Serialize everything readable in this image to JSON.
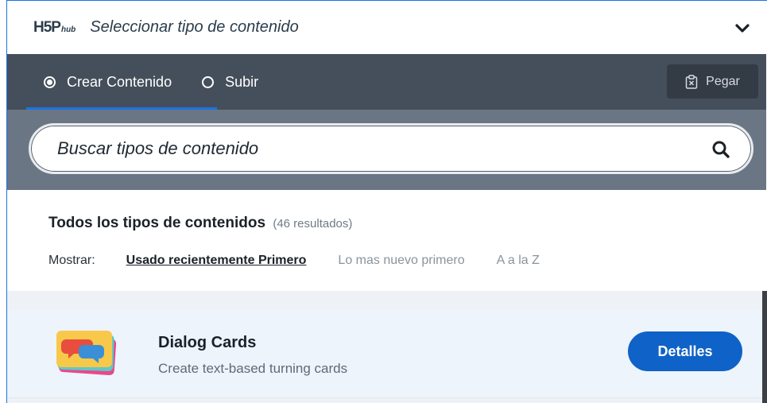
{
  "header": {
    "logo_main": "H5P",
    "logo_sub": "hub",
    "title": "Seleccionar tipo de contenido"
  },
  "tabs": [
    {
      "label": "Crear Contenido",
      "active": true
    },
    {
      "label": "Subir",
      "active": false
    }
  ],
  "paste": {
    "label": "Pegar"
  },
  "search": {
    "placeholder": "Buscar tipos de contenido"
  },
  "list": {
    "title": "Todos los tipos de contenidos",
    "count": "(46 resultados)",
    "sort_label": "Mostrar:",
    "sort_options": [
      {
        "label": "Usado recientemente Primero",
        "active": true
      },
      {
        "label": "Lo mas nuevo primero",
        "active": false
      },
      {
        "label": "A a la Z",
        "active": false
      }
    ],
    "items": [
      {
        "title": "Dialog Cards",
        "description": "Create text-based turning cards",
        "button_label": "Detalles",
        "icon": "dialog-cards-icon"
      }
    ]
  },
  "colors": {
    "tab_bar": "#454f5c",
    "search_area": "#6b7685",
    "accent": "#1a73e8",
    "details_button": "#0f62c7"
  }
}
